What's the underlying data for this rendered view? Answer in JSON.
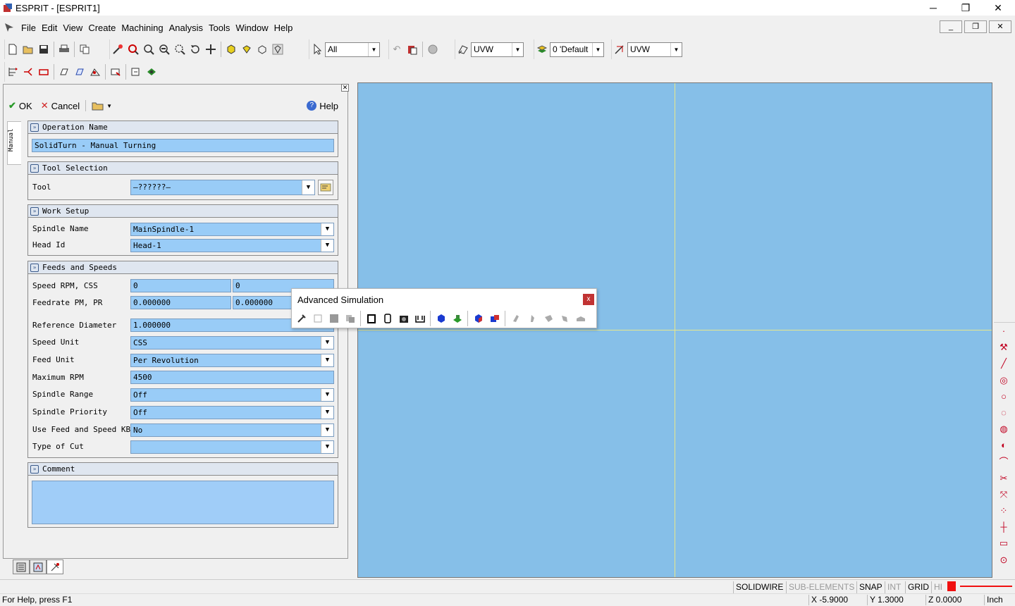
{
  "window": {
    "title": "ESPRIT - [ESPRIT1]",
    "min": "─",
    "restore": "❐",
    "close": "✕"
  },
  "menu": [
    "File",
    "Edit",
    "View",
    "Create",
    "Machining",
    "Analysis",
    "Tools",
    "Window",
    "Help"
  ],
  "mdi": {
    "min": "_",
    "restore": "❐",
    "close": "✕"
  },
  "toolbar": {
    "select_filter": "All",
    "plane1": "UVW",
    "layer": "0 'Default",
    "plane2": "UVW"
  },
  "panel": {
    "ok": "OK",
    "cancel": "Cancel",
    "help": "Help",
    "vtab": "Manual",
    "operation_name": {
      "header": "Operation Name",
      "value": "SolidTurn - Manual Turning"
    },
    "tool_selection": {
      "header": "Tool Selection",
      "tool_label": "Tool",
      "tool_value": "—??????—"
    },
    "work_setup": {
      "header": "Work Setup",
      "spindle_label": "Spindle Name",
      "spindle_value": "MainSpindle-1",
      "head_label": "Head Id",
      "head_value": "Head-1"
    },
    "feeds": {
      "header": "Feeds and Speeds",
      "rows": [
        {
          "label": "Speed RPM, CSS",
          "v1": "0",
          "v2": "0"
        },
        {
          "label": "Feedrate PM, PR",
          "v1": "0.000000",
          "v2": "0.000000"
        },
        {
          "label": "Reference Diameter",
          "value": "1.000000"
        },
        {
          "label": "Speed Unit",
          "value": "CSS"
        },
        {
          "label": "Feed Unit",
          "value": "Per Revolution"
        },
        {
          "label": "Maximum RPM",
          "value": "4500"
        },
        {
          "label": "Spindle Range",
          "value": "Off"
        },
        {
          "label": "Spindle Priority",
          "value": "Off"
        },
        {
          "label": "Use Feed and Speed KB",
          "value": "No"
        },
        {
          "label": "Type of Cut",
          "value": ""
        }
      ]
    },
    "comment": {
      "header": "Comment",
      "value": ""
    }
  },
  "adv_sim": {
    "title": "Advanced Simulation",
    "close": "x"
  },
  "status": {
    "modes": [
      "SOLIDWIRE",
      "SUB-ELEMENTS",
      "SNAP",
      "INT",
      "GRID",
      "HI"
    ],
    "help": "For Help, press F1",
    "x": "X -5.9000",
    "y": "Y 1.3000",
    "z": "Z 0.0000",
    "unit": "Inch"
  }
}
